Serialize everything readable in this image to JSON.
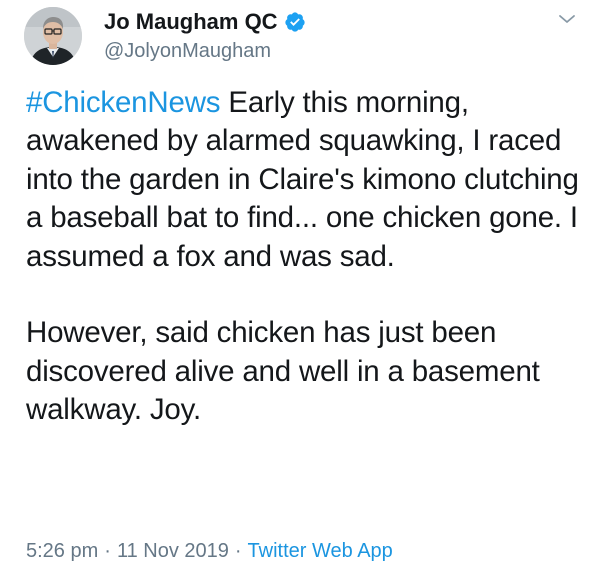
{
  "author": {
    "display_name": "Jo Maugham QC",
    "handle": "@JolyonMaugham",
    "verified": true
  },
  "tweet": {
    "hashtag": "#ChickenNews",
    "paragraph_1_rest": " Early this morning, awakened by alarmed squawking, I raced into the garden in Claire's kimono clutching a baseball bat to find... one chicken gone. I assumed a fox and was sad.",
    "paragraph_2": "However, said chicken has just been discovered alive and well in a basement walkway. Joy."
  },
  "meta": {
    "time": "5:26 pm",
    "separator": "·",
    "date": "11 Nov 2019",
    "source": "Twitter Web App"
  },
  "colors": {
    "link": "#1b95e0",
    "verified_badge": "#1da1f2",
    "secondary_text": "#657786",
    "primary_text": "#14171a"
  },
  "icons": {
    "verified": "verified-badge-icon",
    "menu": "chevron-down-icon"
  }
}
